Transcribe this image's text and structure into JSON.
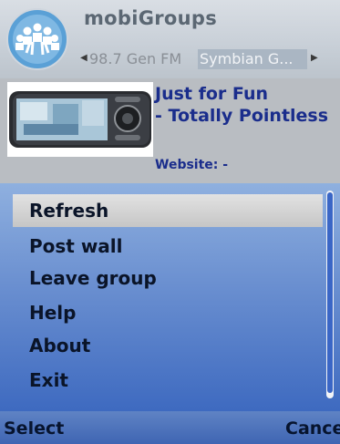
{
  "app": {
    "title": "mobiGroups"
  },
  "tabs": {
    "previous": "98.7 Gen FM",
    "active": "Symbian G..."
  },
  "group": {
    "name": "Just for Fun\n- Totally Pointless",
    "website_label": "Website: -"
  },
  "menu": {
    "items": [
      {
        "label": "Refresh",
        "selected": true
      },
      {
        "label": "Post wall"
      },
      {
        "label": "Leave group"
      },
      {
        "label": "Help"
      },
      {
        "label": "About"
      },
      {
        "label": "Exit"
      }
    ]
  },
  "softkeys": {
    "left": "Select",
    "right": "Cancel"
  },
  "colors": {
    "title": "#5b6773",
    "group_text": "#1a2d8c",
    "menu_gradient_top": "#8fb0df",
    "menu_gradient_bottom": "#3e6ac0",
    "highlight": "#d6d6d6"
  }
}
